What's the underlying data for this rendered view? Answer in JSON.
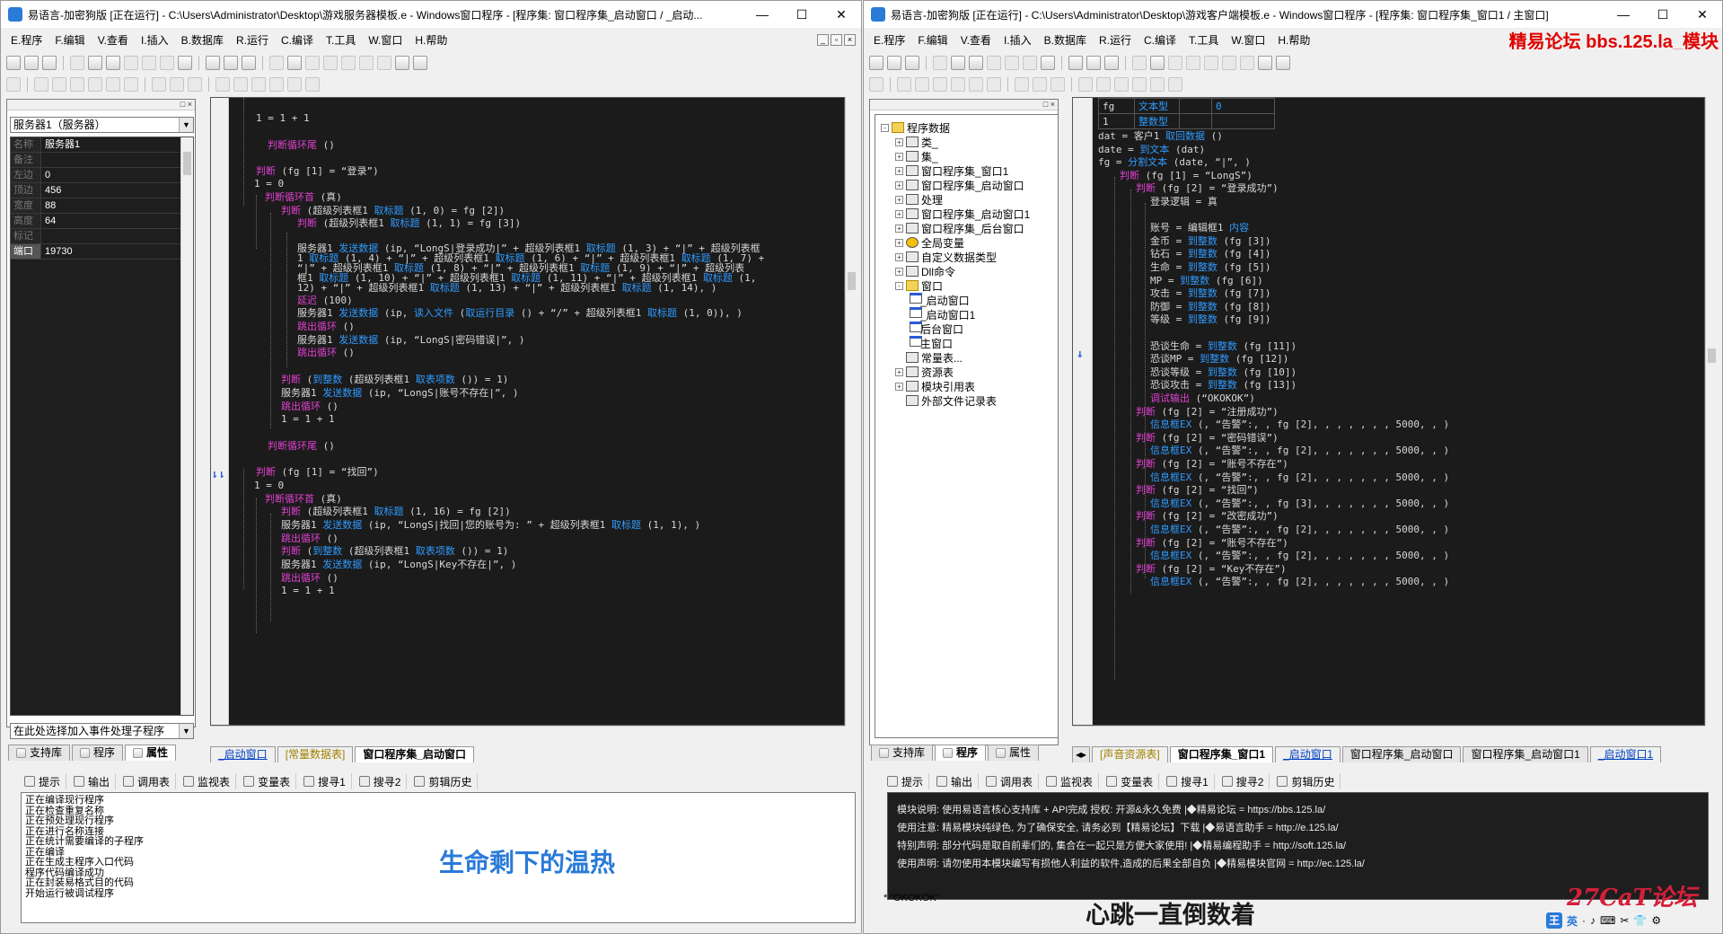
{
  "left": {
    "title": "易语言-加密狗版 [正在运行] - C:\\Users\\Administrator\\Desktop\\游戏服务器模板.e - Windows窗口程序 - [程序集: 窗口程序集_启动窗口 / _启动...",
    "menu": [
      "E.程序",
      "F.编辑",
      "V.查看",
      "I.插入",
      "B.数据库",
      "R.运行",
      "C.编译",
      "T.工具",
      "W.窗口",
      "H.帮助"
    ],
    "object_combo": "服务器1（服务器）",
    "props": [
      {
        "k": "名称",
        "v": "服务器1"
      },
      {
        "k": "备注",
        "v": ""
      },
      {
        "k": "左边",
        "v": "0"
      },
      {
        "k": "顶边",
        "v": "456"
      },
      {
        "k": "宽度",
        "v": "88"
      },
      {
        "k": "高度",
        "v": "64"
      },
      {
        "k": "标记",
        "v": ""
      },
      {
        "k": "端口",
        "v": "19730"
      }
    ],
    "event_combo": "在此处选择加入事件处理子程序",
    "left_tabs": [
      "支持库",
      "程序",
      "属性"
    ],
    "editor_tabs": [
      "_启动窗口",
      "[常量数据表]",
      "窗口程序集_启动窗口"
    ],
    "code": [
      {
        "t": "1 = 1 + 1"
      },
      {
        "t": "判断循环尾 ()"
      },
      {
        "t": "判断 (fg [1] = “登录”)"
      },
      {
        "t": "1 = 0"
      },
      {
        "t": "判断循环首 (真)"
      },
      {
        "t": "判断 (超级列表框1 取标题 (1, 0) = fg [2])"
      },
      {
        "t": "判断 (超级列表框1 取标题 (1, 1) = fg [3])"
      },
      {
        "t": "服务器1 发送数据 (ip, “LongS|登录成功|” + 超级列表框1 取标题 (1, 3) + “|” + 超级列表框"
      },
      {
        "t": "1 取标题 (1, 4) + “|” + 超级列表框1 取标题 (1, 6) + “|” + 超级列表框1 取标题 (1, 7) +"
      },
      {
        "t": "“|” + 超级列表框1 取标题 (1, 8) + “|” + 超级列表框1 取标题 (1, 9) + “|” + 超级列表"
      },
      {
        "t": "框1 取标题 (1, 10) + “|” + 超级列表框1 取标题 (1, 11) + “|” + 超级列表框1 取标题 (1,"
      },
      {
        "t": "12) + “|” + 超级列表框1 取标题 (1, 13) + “|” + 超级列表框1 取标题 (1, 14), )"
      },
      {
        "t": "延迟 (100)"
      },
      {
        "t": "服务器1 发送数据 (ip, 读入文件 (取运行目录 () + “/” + 超级列表框1 取标题 (1, 0)), )"
      },
      {
        "t": "跳出循环 ()"
      },
      {
        "t": "服务器1 发送数据 (ip, “LongS|密码错误|”, )"
      },
      {
        "t": "跳出循环 ()"
      },
      {
        "t": "判断 (到整数 (超级列表框1 取表项数 ()) = 1)"
      },
      {
        "t": "服务器1 发送数据 (ip, “LongS|账号不存在|”, )"
      },
      {
        "t": "跳出循环 ()"
      },
      {
        "t": "1 = 1 + 1"
      },
      {
        "t": "判断循环尾 ()"
      },
      {
        "t": "判断 (fg [1] = “找回”)"
      },
      {
        "t": "1 = 0"
      },
      {
        "t": "判断循环首 (真)"
      },
      {
        "t": "判断 (超级列表框1 取标题 (1, 16) = fg [2])"
      },
      {
        "t": "服务器1 发送数据 (ip, “LongS|找回|您的账号为: ” + 超级列表框1 取标题 (1, 1), )"
      },
      {
        "t": "跳出循环 ()"
      },
      {
        "t": "判断 (到整数 (超级列表框1 取表项数 ()) = 1)"
      },
      {
        "t": "服务器1 发送数据 (ip, “LongS|Key不存在|”, )"
      },
      {
        "t": "跳出循环 ()"
      },
      {
        "t": "1 = 1 + 1"
      }
    ],
    "bottom_tabs": [
      "提示",
      "输出",
      "调用表",
      "监视表",
      "变量表",
      "搜寻1",
      "搜寻2",
      "剪辑历史"
    ],
    "output": [
      "正在编译现行程序",
      "正在检查重复名称",
      "正在预处理现行程序",
      "正在进行名称连接",
      "正在统计需要编译的子程序",
      "正在编译",
      "正在生成主程序入口代码",
      "程序代码编译成功",
      "正在封装易格式目的代码",
      "开始运行被调试程序"
    ],
    "subtitle": "生命剩下的温热"
  },
  "right": {
    "title": "易语言-加密狗版 [正在运行] - C:\\Users\\Administrator\\Desktop\\游戏客户端模板.e - Windows窗口程序 - [程序集: 窗口程序集_窗口1 / 主窗口]",
    "menu": [
      "E.程序",
      "F.编辑",
      "V.查看",
      "I.插入",
      "B.数据库",
      "R.运行",
      "C.编译",
      "T.工具",
      "W.窗口",
      "H.帮助"
    ],
    "red_tag": "精易论坛 bbs.125.la_模块",
    "tree": [
      {
        "label": "程序数据",
        "lvl": 0,
        "ic": "folder",
        "pm": "-"
      },
      {
        "label": "类_",
        "lvl": 1,
        "ic": "box",
        "pm": "+"
      },
      {
        "label": "集_",
        "lvl": 1,
        "ic": "box",
        "pm": "+"
      },
      {
        "label": "窗口程序集_窗口1",
        "lvl": 1,
        "ic": "box",
        "pm": "+"
      },
      {
        "label": "窗口程序集_启动窗口",
        "lvl": 1,
        "ic": "box",
        "pm": "+"
      },
      {
        "label": "处理",
        "lvl": 1,
        "ic": "box",
        "pm": "+"
      },
      {
        "label": "窗口程序集_启动窗口1",
        "lvl": 1,
        "ic": "box",
        "pm": "+"
      },
      {
        "label": "窗口程序集_后台窗口",
        "lvl": 1,
        "ic": "box",
        "pm": "+"
      },
      {
        "label": "全局变量",
        "lvl": 1,
        "ic": "gold",
        "pm": "+"
      },
      {
        "label": "自定义数据类型",
        "lvl": 1,
        "ic": "box",
        "pm": "+"
      },
      {
        "label": "Dll命令",
        "lvl": 1,
        "ic": "box",
        "pm": "+"
      },
      {
        "label": "窗口",
        "lvl": 1,
        "ic": "folder",
        "pm": "-"
      },
      {
        "label": "_启动窗口",
        "lvl": 2,
        "ic": "win",
        "pm": ""
      },
      {
        "label": "_启动窗口1",
        "lvl": 2,
        "ic": "win",
        "pm": ""
      },
      {
        "label": "后台窗口",
        "lvl": 2,
        "ic": "win",
        "pm": ""
      },
      {
        "label": "主窗口",
        "lvl": 2,
        "ic": "win",
        "pm": ""
      },
      {
        "label": "常量表...",
        "lvl": 1,
        "ic": "box",
        "pm": ""
      },
      {
        "label": "资源表",
        "lvl": 1,
        "ic": "box",
        "pm": "+"
      },
      {
        "label": "模块引用表",
        "lvl": 1,
        "ic": "box",
        "pm": "+"
      },
      {
        "label": "外部文件记录表",
        "lvl": 1,
        "ic": "box",
        "pm": ""
      }
    ],
    "var_table": [
      [
        "fg",
        "文本型",
        "",
        "0"
      ],
      [
        "1",
        "整数型",
        "",
        ""
      ]
    ],
    "code": [
      "dat = 客户1 取回数据 ()",
      "date = 到文本 (dat)",
      "fg = 分割文本 (date, “|”, )",
      "判断 (fg [1] = “LongS”)",
      "判断 (fg [2] = “登录成功”)",
      "登录逻辑 = 真",
      "",
      "账号 = 编辑框1 内容",
      "金币 = 到整数 (fg [3])",
      "钻石 = 到整数 (fg [4])",
      "生命 = 到整数 (fg [5])",
      "MP = 到整数 (fg [6])",
      "攻击 = 到整数 (fg [7])",
      "防御 = 到整数 (fg [8])",
      "等级 = 到整数 (fg [9])",
      "",
      "恐谈生命 = 到整数 (fg [11])",
      "恐谈MP = 到整数 (fg [12])",
      "恐谈等级 = 到整数 (fg [10])",
      "恐谈攻击 = 到整数 (fg [13])",
      "调试输出 (“OKOKOK”)",
      "判断 (fg [2] = “注册成功”)",
      "信息框EX (, “告警”:, , fg [2], , , , , , , 5000, , )",
      "判断 (fg [2] = “密码错误”)",
      "信息框EX (, “告警”:, , fg [2], , , , , , , 5000, , )",
      "判断 (fg [2] = “账号不存在”)",
      "信息框EX (, “告警”:, , fg [2], , , , , , , 5000, , )",
      "判断 (fg [2] = “找回”)",
      "信息框EX (, “告警”:, , fg [3], , , , , , , 5000, , )",
      "判断 (fg [2] = “改密成功”)",
      "信息框EX (, “告警”:, , fg [2], , , , , , , 5000, , )",
      "判断 (fg [2] = “账号不存在”)",
      "信息框EX (, “告警”:, , fg [2], , , , , , , 5000, , )",
      "判断 (fg [2] = “Key不存在”)",
      "信息框EX (, “告警”:, , fg [2], , , , , , , 5000, , )"
    ],
    "left_tabs": [
      "支持库",
      "程序",
      "属性"
    ],
    "editor_tabs": [
      "[声音资源表]",
      "窗口程序集_窗口1",
      "_启动窗口",
      "窗口程序集_启动窗口",
      "窗口程序集_启动窗口1",
      "_启动窗口1"
    ],
    "bottom_tabs": [
      "提示",
      "输出",
      "调用表",
      "监视表",
      "变量表",
      "搜寻1",
      "搜寻2",
      "剪辑历史"
    ],
    "output": [
      "模块说明: 使用易语言核心支持库 + API完成     授权: 开源&永久免费  |◆精易论坛      = https://bbs.125.la/",
      "使用注意: 精易模块纯绿色, 为了确保安全, 请务必到【精易论坛】下载  |◆易语言助手     = http://e.125.la/",
      "特别声明: 部分代码是取自前辈们的, 集合在一起只是方便大家使用!    |◆精易编程助手   = http://soft.125.la/",
      "使用声明: 请勿使用本模块编写有损他人利益的软件,造成的后果全部自负  |◆精易模块官网   = http://ec.125.la/"
    ],
    "debug_line": "* “OKOKOK”",
    "subtitle": "心跳一直倒数着",
    "watermark": "27CaT论坛",
    "tray": [
      "王",
      "英",
      "·",
      "♪",
      "⌨",
      "✂",
      "👕",
      "⚙"
    ]
  },
  "colors": {
    "keyword": "#e040d0",
    "func": "#2f9bff",
    "bg": "#1b1b1b",
    "subtitle_left": "#2a7ad8",
    "subtitle_right": "#1a1a1a",
    "red": "#e00000"
  }
}
